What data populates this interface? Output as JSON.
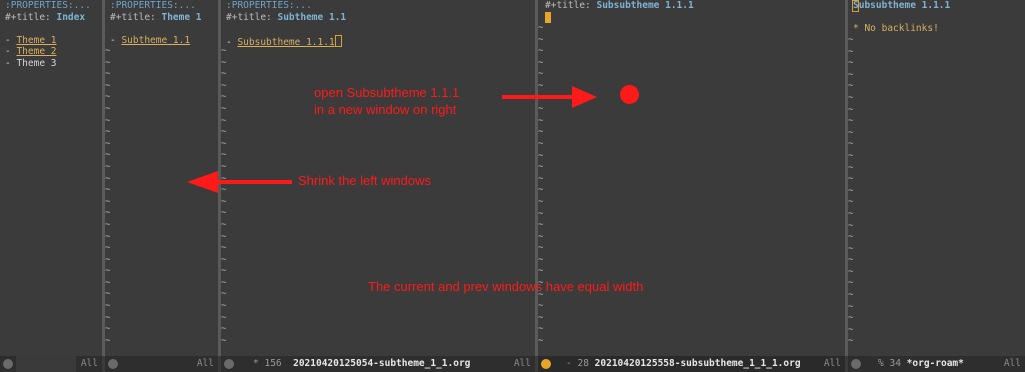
{
  "windows": [
    {
      "lines": [
        ":PROPERTIES:...",
        "#+title: ",
        "",
        "- ",
        "- ",
        "- Theme 3"
      ],
      "title": "Index",
      "links": [
        "Theme 1",
        "Theme 2"
      ],
      "mode": {
        "percent": "",
        "count": "",
        "filename": "",
        "position": "All"
      }
    },
    {
      "lines": [
        ":PROPERTIES:...",
        "#+title: "
      ],
      "title": "Theme 1",
      "link_prefix": "- ",
      "link": "Subtheme 1.1",
      "mode": {
        "percent": "",
        "count": "",
        "filename": "",
        "position": "All"
      }
    },
    {
      "lines": [
        ":PROPERTIES:...",
        "#+title: "
      ],
      "title": "Subtheme 1.1",
      "link_prefix": "- ",
      "link": "Subsubtheme 1.1.1",
      "mode": {
        "percent": "*",
        "count": "156",
        "filename": "20210420125054-subtheme_1_1.org",
        "position": "All"
      }
    },
    {
      "lines": [
        "#+title: "
      ],
      "title": "Subsubtheme 1.1.1",
      "mode": {
        "percent": "-",
        "count": "28",
        "filename": "20210420125558-subsubtheme_1_1_1.org",
        "position": "All"
      }
    },
    {
      "title": "Subsubtheme 1.1.1",
      "backlinks": "* No backlinks!",
      "mode": {
        "percent": "%",
        "count": "34",
        "filename": "*org-roam*",
        "position": "All"
      }
    }
  ],
  "annotations": {
    "open_note": "open Subsubtheme 1.1.1\nin a new window on right",
    "shrink_note": "Shrink the left windows",
    "equal_note": "The current and prev windows have equal width"
  },
  "colors": {
    "background": "#3b3b3b",
    "annotation": "#ff1a1a",
    "link": "#d8b060",
    "title": "#7fb3d3",
    "cursor": "#e8a628"
  },
  "icons": [
    "info-icon",
    "cursor-icon",
    "arrow-right-icon",
    "arrow-left-icon",
    "red-dot-icon"
  ]
}
